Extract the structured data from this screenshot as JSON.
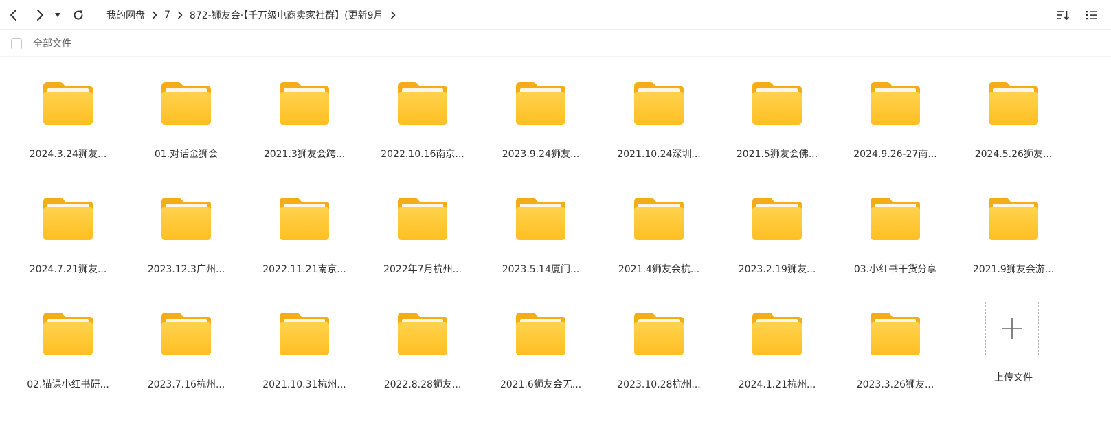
{
  "toolbar": {
    "icons": {
      "back": "chevron-left-icon",
      "forward": "chevron-right-icon",
      "dropdown": "caret-down-icon",
      "refresh": "refresh-icon",
      "sort": "sort-icon",
      "view": "list-view-icon"
    },
    "breadcrumb": [
      "我的网盘",
      "7",
      "872-狮友会·【千万级电商卖家社群】(更新9月"
    ]
  },
  "select_bar": {
    "label": "全部文件",
    "checked": false
  },
  "items": [
    {
      "name": "2024.3.24狮友..."
    },
    {
      "name": "01.对话金狮会"
    },
    {
      "name": "2021.3狮友会跨..."
    },
    {
      "name": "2022.10.16南京..."
    },
    {
      "name": "2023.9.24狮友..."
    },
    {
      "name": "2021.10.24深圳..."
    },
    {
      "name": "2021.5狮友会佛..."
    },
    {
      "name": "2024.9.26-27南..."
    },
    {
      "name": "2024.5.26狮友..."
    },
    {
      "name": "2024.7.21狮友..."
    },
    {
      "name": "2023.12.3广州..."
    },
    {
      "name": "2022.11.21南京..."
    },
    {
      "name": "2022年7月杭州..."
    },
    {
      "name": "2023.5.14厦门..."
    },
    {
      "name": "2021.4狮友会杭..."
    },
    {
      "name": "2023.2.19狮友..."
    },
    {
      "name": "03.小红书干货分享"
    },
    {
      "name": "2021.9狮友会游..."
    },
    {
      "name": "02.猫课小红书研..."
    },
    {
      "name": "2023.7.16杭州..."
    },
    {
      "name": "2021.10.31杭州..."
    },
    {
      "name": "2022.8.28狮友..."
    },
    {
      "name": "2021.6狮友会无..."
    },
    {
      "name": "2023.10.28杭州..."
    },
    {
      "name": "2024.1.21杭州..."
    },
    {
      "name": "2023.3.26狮友..."
    }
  ],
  "upload": {
    "label": "上传文件",
    "icon": "plus-icon"
  },
  "colors": {
    "folder_body": "#ffc93f",
    "folder_back": "#f6b21c",
    "text": "#333333"
  }
}
